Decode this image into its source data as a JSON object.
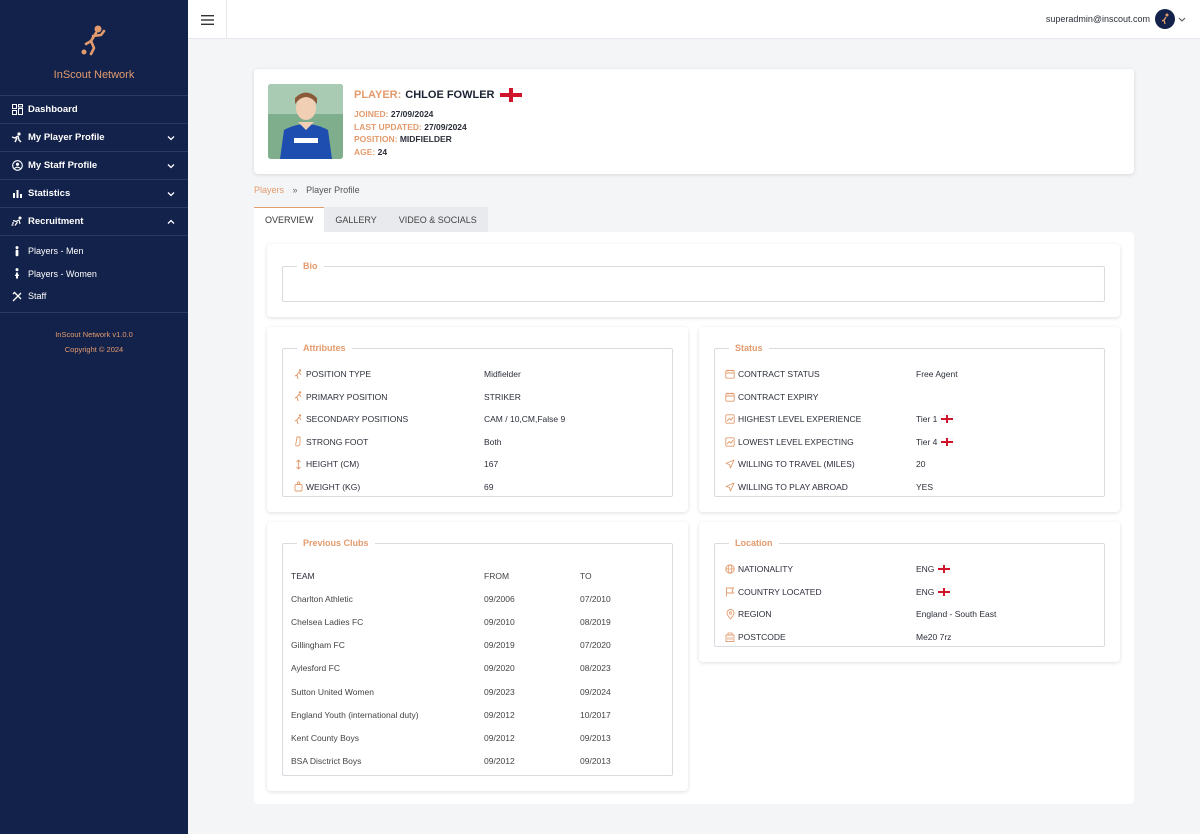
{
  "brand": {
    "name": "InScout Network"
  },
  "nav": {
    "items": [
      {
        "label": "Dashboard",
        "icon": "dashboard-icon"
      },
      {
        "label": "My Player Profile",
        "icon": "player-icon"
      },
      {
        "label": "My Staff Profile",
        "icon": "staff-icon"
      },
      {
        "label": "Statistics",
        "icon": "bar-chart-icon"
      },
      {
        "label": "Recruitment",
        "icon": "recruitment-icon"
      }
    ],
    "subitems": [
      {
        "label": "Players - Men"
      },
      {
        "label": "Players - Women"
      },
      {
        "label": "Staff"
      }
    ],
    "version": "InScout Network v1.0.0",
    "copyright": "Copyright © 2024"
  },
  "topbar": {
    "user_email": "superadmin@inscout.com"
  },
  "profile": {
    "player_key": "PLAYER:",
    "player_name": "CHLOE FOWLER",
    "joined_key": "JOINED:",
    "joined": "27/09/2024",
    "updated_key": "LAST UPDATED:",
    "updated": "27/09/2024",
    "position_key": "POSITION:",
    "position": "MIDFIELDER",
    "age_key": "AGE:",
    "age": "24"
  },
  "breadcrumb": {
    "link": "Players",
    "sep": "»",
    "current": "Player Profile"
  },
  "tabs": [
    "OVERVIEW",
    "GALLERY",
    "VIDEO & SOCIALS"
  ],
  "bio": {
    "legend": "Bio"
  },
  "attributes": {
    "legend": "Attributes",
    "rows": [
      {
        "key": "POSITION TYPE",
        "value": "Midfielder"
      },
      {
        "key": "PRIMARY POSITION",
        "value": "STRIKER"
      },
      {
        "key": "SECONDARY POSITIONS",
        "value": "CAM / 10,CM,False 9"
      },
      {
        "key": "STRONG FOOT",
        "value": "Both"
      },
      {
        "key": "HEIGHT (CM)",
        "value": "167"
      },
      {
        "key": "WEIGHT (KG)",
        "value": "69"
      }
    ]
  },
  "status": {
    "legend": "Status",
    "rows": [
      {
        "key": "CONTRACT STATUS",
        "value": "Free Agent"
      },
      {
        "key": "CONTRACT EXPIRY",
        "value": ""
      },
      {
        "key": "HIGHEST LEVEL EXPERIENCE",
        "value": "Tier 1"
      },
      {
        "key": "LOWEST LEVEL EXPECTING",
        "value": "Tier 4"
      },
      {
        "key": "WILLING TO TRAVEL (MILES)",
        "value": "20"
      },
      {
        "key": "WILLING TO PLAY ABROAD",
        "value": "YES"
      }
    ]
  },
  "clubs": {
    "legend": "Previous Clubs",
    "headers": [
      "TEAM",
      "FROM",
      "TO"
    ],
    "rows": [
      [
        "Charlton Athletic",
        "09/2006",
        "07/2010"
      ],
      [
        "Chelsea Ladies FC",
        "09/2010",
        "08/2019"
      ],
      [
        "Gillingham FC",
        "09/2019",
        "07/2020"
      ],
      [
        "Aylesford FC",
        "09/2020",
        "08/2023"
      ],
      [
        "Sutton United Women",
        "09/2023",
        "09/2024"
      ],
      [
        "England Youth (international duty)",
        "09/2012",
        "10/2017"
      ],
      [
        "Kent County Boys",
        "09/2012",
        "09/2013"
      ],
      [
        "BSA Disctrict Boys",
        "09/2012",
        "09/2013"
      ]
    ]
  },
  "location": {
    "legend": "Location",
    "rows": [
      {
        "key": "NATIONALITY",
        "value": "ENG"
      },
      {
        "key": "COUNTRY LOCATED",
        "value": "ENG"
      },
      {
        "key": "REGION",
        "value": "England - South East"
      },
      {
        "key": "POSTCODE",
        "value": "Me20 7rz"
      }
    ]
  },
  "colors": {
    "sidebar": "#13224a",
    "accent": "#e39b6e",
    "flag_red": "#cf142b"
  }
}
